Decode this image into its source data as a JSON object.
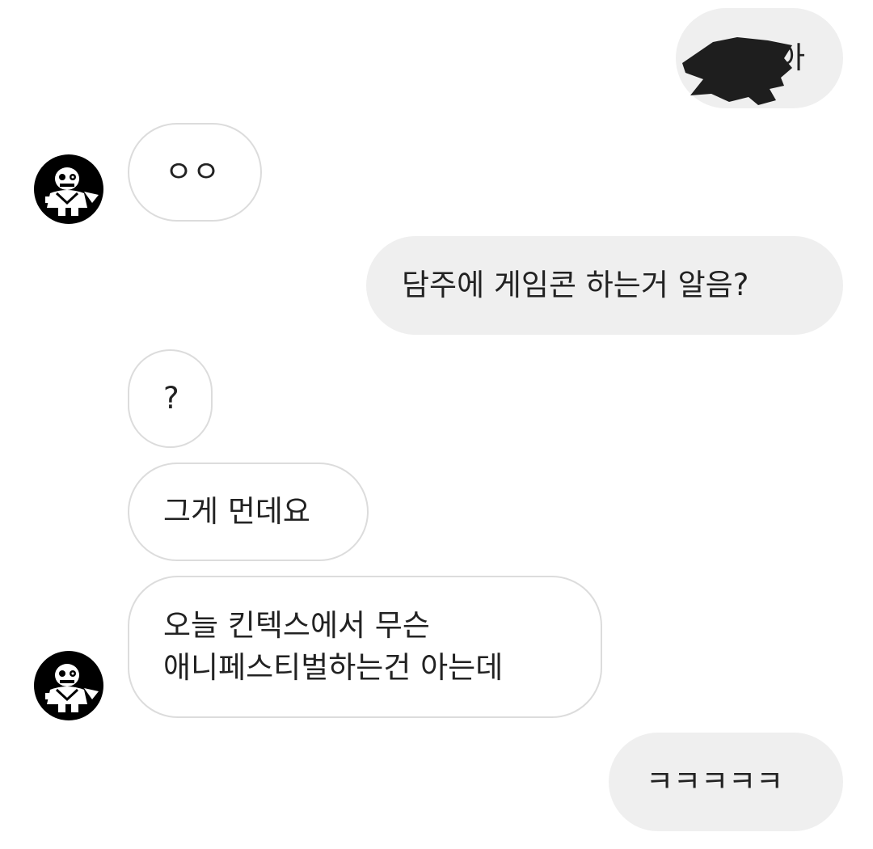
{
  "conversation": {
    "messages": [
      {
        "id": "m1",
        "sender": "me",
        "text": "아",
        "redacted_prefix": true
      },
      {
        "id": "m2",
        "sender": "other",
        "text": "ㅇㅇ"
      },
      {
        "id": "m3",
        "sender": "me",
        "text": "담주에 게임콘 하는거 알음?"
      },
      {
        "id": "m4",
        "sender": "other",
        "text": "?"
      },
      {
        "id": "m5",
        "sender": "other",
        "text": "그게 먼데요"
      },
      {
        "id": "m6",
        "sender": "other",
        "lines": [
          "오늘 킨텍스에서 무슨",
          "애니페스티벌하는건 아는데"
        ]
      },
      {
        "id": "m7",
        "sender": "me",
        "text": "ㅋㅋㅋㅋㅋ"
      }
    ]
  },
  "avatar": {
    "icon": "skeleton-character-icon",
    "background": "#000000"
  },
  "colors": {
    "sent_bubble": "#efefef",
    "received_border": "#dcdcdc",
    "text": "#222222",
    "redaction": "#1e1e1e"
  }
}
